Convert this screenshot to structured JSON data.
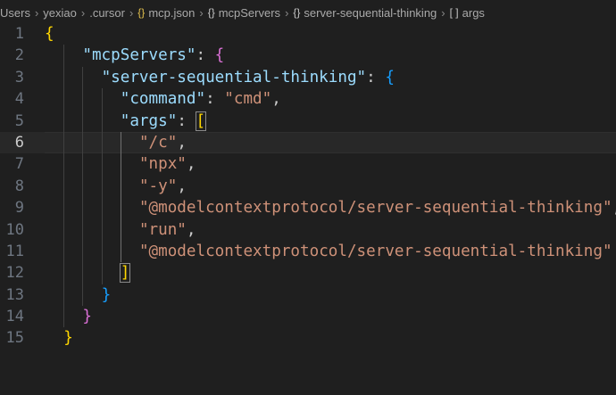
{
  "breadcrumb": {
    "items": [
      {
        "label": "Users",
        "icon": ""
      },
      {
        "label": "yexiao",
        "icon": ""
      },
      {
        "label": ".cursor",
        "icon": ""
      },
      {
        "label": "mcp.json",
        "icon": "{}"
      },
      {
        "label": "mcpServers",
        "icon": "{}"
      },
      {
        "label": "server-sequential-thinking",
        "icon": "{}"
      },
      {
        "label": "args",
        "icon": "[ ]"
      }
    ],
    "separator": "›"
  },
  "editor": {
    "active_line": 6,
    "lines": [
      {
        "num": "1",
        "text": "{"
      },
      {
        "num": "2",
        "text": "    \"mcpServers\": {"
      },
      {
        "num": "3",
        "text": "      \"server-sequential-thinking\": {"
      },
      {
        "num": "4",
        "text": "        \"command\": \"cmd\","
      },
      {
        "num": "5",
        "text": "        \"args\": ["
      },
      {
        "num": "6",
        "text": "          \"/c\","
      },
      {
        "num": "7",
        "text": "          \"npx\","
      },
      {
        "num": "8",
        "text": "          \"-y\","
      },
      {
        "num": "9",
        "text": "          \"@modelcontextprotocol/server-sequential-thinking\","
      },
      {
        "num": "10",
        "text": "          \"run\","
      },
      {
        "num": "11",
        "text": "          \"@modelcontextprotocol/server-sequential-thinking\""
      },
      {
        "num": "12",
        "text": "        ]"
      },
      {
        "num": "13",
        "text": "      }"
      },
      {
        "num": "14",
        "text": "    }"
      },
      {
        "num": "15",
        "text": "  }"
      }
    ]
  },
  "colors": {
    "background": "#1f1f1f",
    "key": "#9cdcfe",
    "string": "#ce9178",
    "bracket_level1": "#ffd700",
    "bracket_level2": "#da70d6",
    "bracket_level3": "#179fff",
    "line_number": "#6e7681"
  }
}
